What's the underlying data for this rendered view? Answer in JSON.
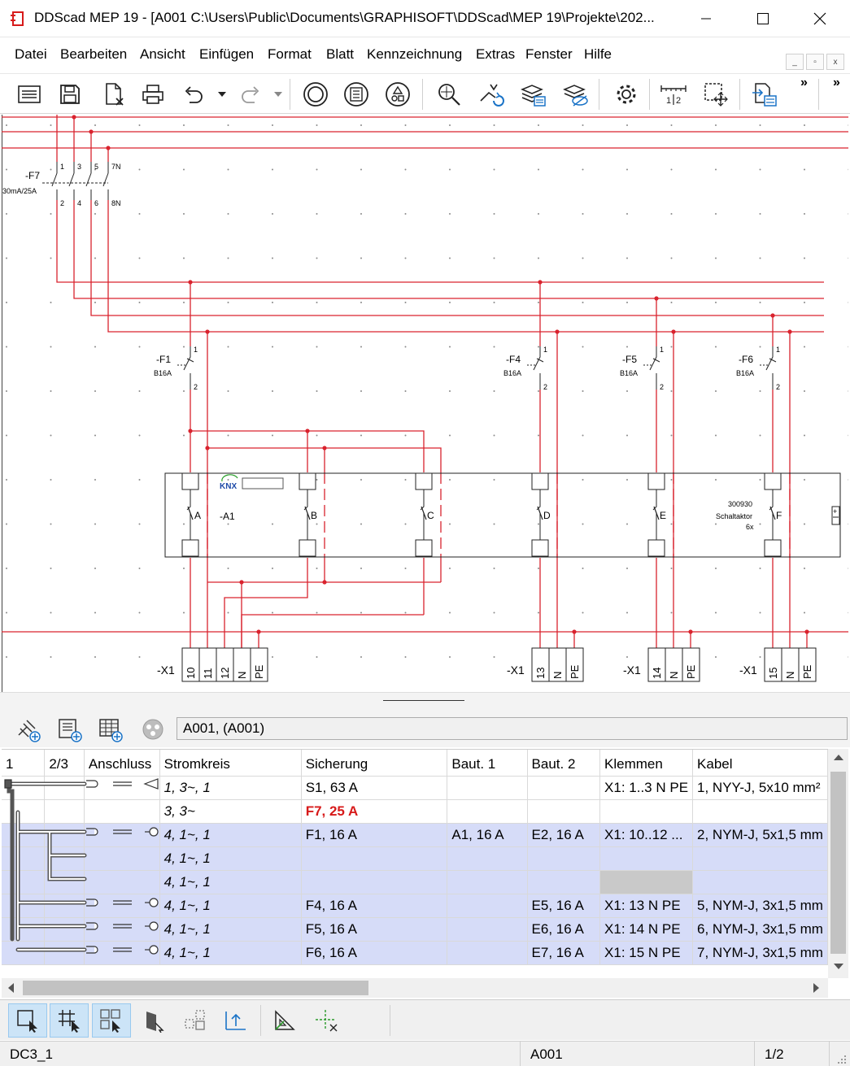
{
  "window": {
    "title": "DDScad MEP 19 - [A001  C:\\Users\\Public\\Documents\\GRAPHISOFT\\DDScad\\MEP 19\\Projekte\\202...",
    "minimize_icon": "minimize-icon",
    "maximize_icon": "maximize-icon",
    "close_icon": "close-icon"
  },
  "menu": {
    "items": [
      "Datei",
      "Bearbeiten",
      "Ansicht",
      "Einfügen",
      "Format",
      "Blatt",
      "Kennzeichnung",
      "Extras",
      "Fenster",
      "Hilfe"
    ]
  },
  "toolbar": {
    "icons": [
      "properties-icon",
      "save-icon",
      "close-document-icon",
      "print-icon",
      "undo-icon",
      "redo-icon",
      "circle-symbol-icon",
      "panel-symbol-icon",
      "components-icon",
      "zoom-icon",
      "route-refresh-icon",
      "layers-list-icon",
      "layers-hide-icon",
      "settings-icon",
      "measure-icon",
      "select-move-icon",
      "export-icon"
    ],
    "overflow": "»"
  },
  "schematic": {
    "main_breaker": {
      "tag": "-F7",
      "rating": "30mA/25A",
      "top_terms": [
        "1",
        "3",
        "5",
        "7N"
      ],
      "bottom_terms": [
        "2",
        "4",
        "6",
        "8N"
      ]
    },
    "breakers": [
      {
        "tag": "-F1",
        "rating": "B16A",
        "t1": "1",
        "t2": "2"
      },
      {
        "tag": "-F4",
        "rating": "B16A",
        "t1": "1",
        "t2": "2"
      },
      {
        "tag": "-F5",
        "rating": "B16A",
        "t1": "1",
        "t2": "2"
      },
      {
        "tag": "-F6",
        "rating": "B16A",
        "t1": "1",
        "t2": "2"
      }
    ],
    "actuator": {
      "tag": "-A1",
      "brand": "KNX",
      "article": "300930",
      "name": "Schaltaktor",
      "count": "6x",
      "channels": [
        "A",
        "B",
        "C",
        "D",
        "E",
        "F"
      ],
      "plus_symbol": "+"
    },
    "terminal_strips": [
      {
        "tag": "-X1",
        "terminals": [
          "10",
          "11",
          "12",
          "N",
          "PE"
        ]
      },
      {
        "tag": "-X1",
        "terminals": [
          "13",
          "N",
          "PE"
        ]
      },
      {
        "tag": "-X1",
        "terminals": [
          "14",
          "N",
          "PE"
        ]
      },
      {
        "tag": "-X1",
        "terminals": [
          "15",
          "N",
          "PE"
        ]
      }
    ]
  },
  "panel": {
    "icons": [
      "add-connection-icon",
      "add-distribution-icon",
      "add-table-icon",
      "cable-reel-icon"
    ],
    "field_value": "A001,  (A001)"
  },
  "table": {
    "columns": [
      "1",
      "2/3",
      "Anschluss",
      "Stromkreis",
      "Sicherung",
      "Baut. 1",
      "Baut. 2",
      "Klemmen",
      "Kabel"
    ],
    "rows": [
      {
        "stromkreis": "1, 3~, 1",
        "sicherung": "S1, 63 A",
        "baut1": "",
        "baut2": "",
        "klemmen": "X1: 1..3 N PE",
        "kabel": "1, NYY-J, 5x10 mm²",
        "selected": false,
        "red": false
      },
      {
        "stromkreis": "3, 3~",
        "sicherung": "F7, 25 A",
        "baut1": "",
        "baut2": "",
        "klemmen": "",
        "kabel": "",
        "selected": false,
        "red": true
      },
      {
        "stromkreis": "4, 1~, 1",
        "sicherung": "F1, 16 A",
        "baut1": "A1, 16 A",
        "baut2": "E2, 16 A",
        "klemmen": "X1: 10..12 ...",
        "kabel": "2, NYM-J, 5x1,5 mm",
        "selected": true,
        "red": false
      },
      {
        "stromkreis": "4, 1~, 1",
        "sicherung": "",
        "baut1": "",
        "baut2": "",
        "klemmen": "",
        "kabel": "",
        "selected": true,
        "red": false
      },
      {
        "stromkreis": "4, 1~, 1",
        "sicherung": "",
        "baut1": "",
        "baut2": "",
        "klemmen": "",
        "kabel": "",
        "selected": true,
        "red": false
      },
      {
        "stromkreis": "4, 1~, 1",
        "sicherung": "F4, 16 A",
        "baut1": "",
        "baut2": "E5, 16 A",
        "klemmen": "X1: 13 N PE",
        "kabel": "5, NYM-J, 3x1,5 mm",
        "selected": true,
        "red": false
      },
      {
        "stromkreis": "4, 1~, 1",
        "sicherung": "F5, 16 A",
        "baut1": "",
        "baut2": "E6, 16 A",
        "klemmen": "X1: 14 N PE",
        "kabel": "6, NYM-J, 3x1,5 mm",
        "selected": true,
        "red": false
      },
      {
        "stromkreis": "4, 1~, 1",
        "sicherung": "F6, 16 A",
        "baut1": "",
        "baut2": "E7, 16 A",
        "klemmen": "X1: 15 N PE",
        "kabel": "7, NYM-J, 3x1,5 mm",
        "selected": true,
        "red": false
      }
    ]
  },
  "bottom_toolbar": {
    "icons": [
      "select-rect-icon",
      "select-nodes-icon",
      "select-group-icon",
      "door-select-icon",
      "arrange-icon",
      "align-icon",
      "triangle-ruler-icon",
      "crosshair-icon"
    ]
  },
  "status": {
    "left": "DC3_1",
    "sheet": "A001",
    "page": "1/2"
  },
  "colors": {
    "wire": "#d9232e",
    "selection": "#d6dcf8",
    "accent": "#cce4f7"
  }
}
